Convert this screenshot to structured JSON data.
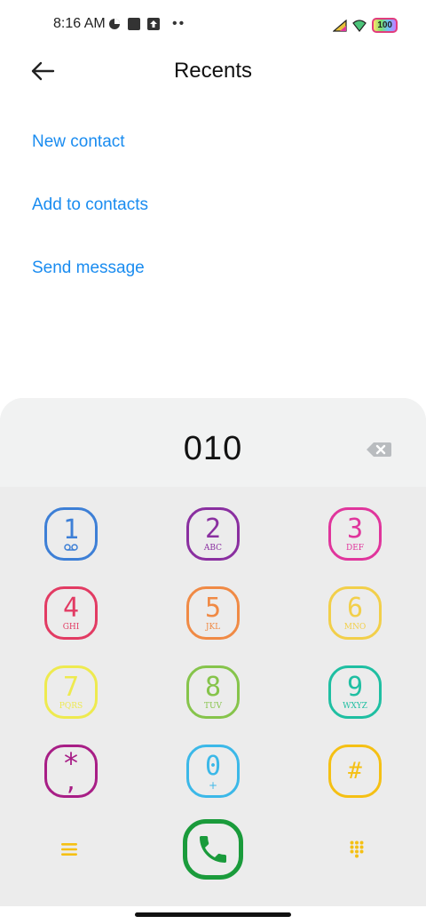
{
  "status_bar": {
    "time": "8:16 AM",
    "battery": "100"
  },
  "header": {
    "title": "Recents"
  },
  "actions": [
    {
      "label": "New contact"
    },
    {
      "label": "Add to contacts"
    },
    {
      "label": "Send message"
    }
  ],
  "dialer": {
    "number": "010"
  },
  "keypad": {
    "keys": [
      {
        "digit": "1",
        "letters": "",
        "color": "#3d7fd6"
      },
      {
        "digit": "2",
        "letters": "ABC",
        "color": "#8a2fa0"
      },
      {
        "digit": "3",
        "letters": "DEF",
        "color": "#e0359c"
      },
      {
        "digit": "4",
        "letters": "GHI",
        "color": "#e23b63"
      },
      {
        "digit": "5",
        "letters": "JKL",
        "color": "#f08a45"
      },
      {
        "digit": "6",
        "letters": "MNO",
        "color": "#f2cf4a"
      },
      {
        "digit": "7",
        "letters": "PQRS",
        "color": "#eeea4f"
      },
      {
        "digit": "8",
        "letters": "TUV",
        "color": "#86c44b"
      },
      {
        "digit": "9",
        "letters": "WXYZ",
        "color": "#1fbfa2"
      },
      {
        "digit": "*",
        "letters": ",",
        "color": "#a81e86"
      },
      {
        "digit": "0",
        "letters": "+",
        "color": "#3bb8e8"
      },
      {
        "digit": "#",
        "letters": "",
        "color": "#f5c014"
      }
    ]
  },
  "colors": {
    "link": "#1a8cf0",
    "call": "#1a9b3b",
    "accent_yellow": "#f5c014"
  },
  "icons": {
    "back": "arrow-left-icon",
    "backspace": "backspace-icon",
    "menu": "menu-icon",
    "call": "phone-icon",
    "keypad": "dialpad-icon",
    "voicemail": "voicemail-icon"
  }
}
